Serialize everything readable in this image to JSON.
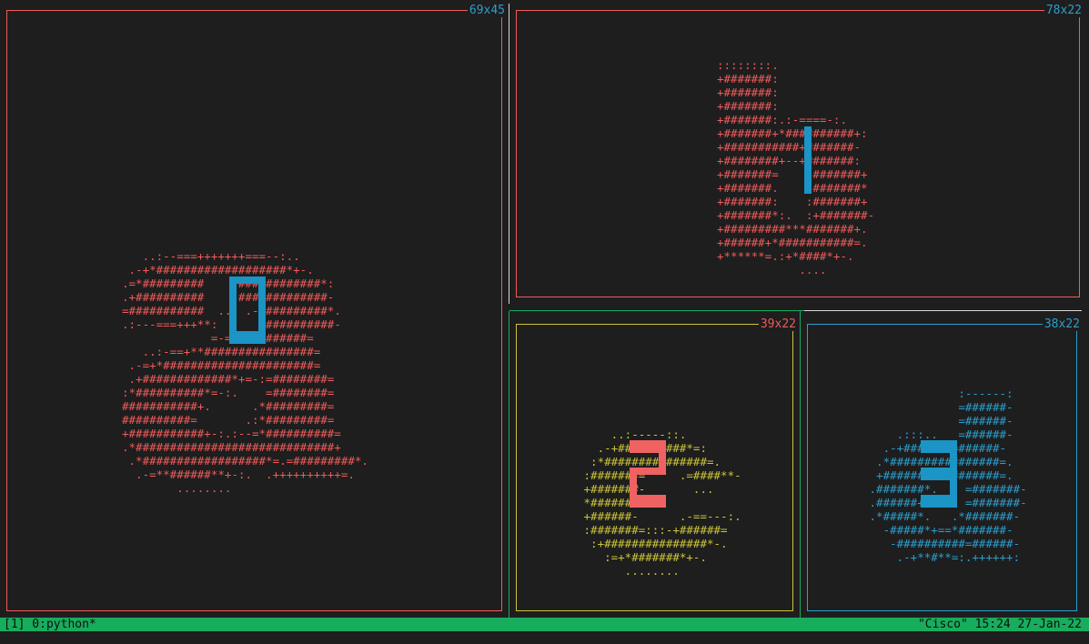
{
  "colors": {
    "background": "#1e1e1e",
    "pane0": "#f05b5b",
    "pane1": "#f05b5b",
    "pane2": "#cbc43a",
    "pane3": "#2a9fcf",
    "digit_blue": "#1b94c6",
    "digit_red": "#f06262",
    "size_label": "#2a9fcf",
    "separator_green": "#17ad5d",
    "status_bar": "#17ad5d"
  },
  "panes": [
    {
      "size_label": "69x45",
      "digit": "0",
      "art": "   ..:--===+++++++===--:..\n .-+*###################*+-.\n.=*#########     ############*:\n.+##########     #############-\n=###########  ..  .-##########*.\n.:---===+++**:      =##########-\n             =-=+##########=\n   ..:-==+**################=\n .-=+*######################=\n .+#############*+=-:=########=\n:*##########*=-:.    =########=\n###########+.      .*#########=\n##########=       .:*#########=\n+###########+-:.:--=*##########=\n.*#############################+\n .*##################*=.=#########*.\n  .-=**######**+-:.  .++++++++++=.\n        ........"
    },
    {
      "size_label": "78x22",
      "digit": "1",
      "art": "::::::::.\n+#######:\n+#######:\n+#######:\n+#######:.:-====-:.\n+#######+*##########+:\n+###########+#######-\n+########+--+#######:\n+#######=    -#######+\n+#######.    .#######*\n+#######:    :#######+\n+#######*:.  :+#######-\n+#########***#######+.\n+######+*###########=.\n+******=.:+*####*+-.\n            ...."
    },
    {
      "size_label": "39x22",
      "digit": "2",
      "art": "     ..:-----::.\n   .-+##########*=:\n  :*###############=.\n :#######=     .=####**-\n +#######-       ...\n *#######\n +######-      .-==---:.\n :#######=:::-+######=\n  :+###############*-.\n    :=+*#######*+-.\n       ........"
    },
    {
      "size_label": "38x22",
      "digit": "3",
      "art": "              :------:\n              =######-\n              =######-\n     .:::..   =######-\n   .-+####+++=######-\n  .*################=.\n  +######*++=#######=.\n .#######*.    =#######-\n .######+.     =#######-\n .*#####*.   .*#######-\n   -#####*+==*#######-\n    -##########=######-\n     .-+**#**=:.++++++:"
    }
  ],
  "status_bar": {
    "session": "[1] 0:python*",
    "right": "\"Cisco\" 15:24 27-Jan-22"
  }
}
